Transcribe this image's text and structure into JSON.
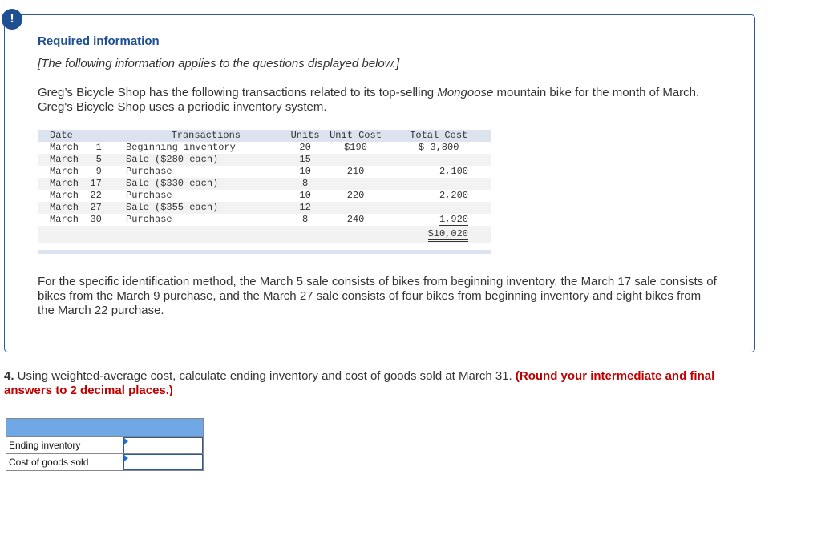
{
  "alert_icon": "!",
  "info": {
    "title": "Required information",
    "subtitle": "[The following information applies to the questions displayed below.]",
    "intro_part1": "Greg’s Bicycle Shop has the following transactions related to its top-selling ",
    "intro_italic": "Mongoose",
    "intro_part2": " mountain bike for the month of March. Greg's Bicycle Shop uses a periodic inventory system.",
    "table": {
      "headers": [
        "Date",
        "Transactions",
        "Units",
        "Unit Cost",
        "Total Cost"
      ],
      "rows": [
        {
          "date": "March   1",
          "transaction": "Beginning inventory",
          "units": "20",
          "unit_cost": "$190",
          "total_cost": "$ 3,800"
        },
        {
          "date": "March   5",
          "transaction": "Sale ($280 each)",
          "units": "15",
          "unit_cost": "",
          "total_cost": ""
        },
        {
          "date": "March   9",
          "transaction": "Purchase",
          "units": "10",
          "unit_cost": "210",
          "total_cost": "2,100"
        },
        {
          "date": "March  17",
          "transaction": "Sale ($330 each)",
          "units": "8",
          "unit_cost": "",
          "total_cost": ""
        },
        {
          "date": "March  22",
          "transaction": "Purchase",
          "units": "10",
          "unit_cost": "220",
          "total_cost": "2,200"
        },
        {
          "date": "March  27",
          "transaction": "Sale ($355 each)",
          "units": "12",
          "unit_cost": "",
          "total_cost": ""
        },
        {
          "date": "March  30",
          "transaction": "Purchase",
          "units": "8",
          "unit_cost": "240",
          "total_cost": "1,920"
        }
      ],
      "total": "$10,020"
    },
    "specific_id_text": "For the specific identification method, the March 5 sale consists of bikes from beginning inventory, the March 17 sale consists of bikes from the March 9 purchase, and the March 27 sale consists of four bikes from beginning inventory and eight bikes from the March 22 purchase."
  },
  "question": {
    "number": "4.",
    "text": " Using weighted-average cost, calculate ending inventory and cost of goods sold at March 31. ",
    "instruction": "(Round your intermediate and final answers to 2 decimal places.)"
  },
  "answer_table": {
    "rows": [
      {
        "label": "Ending inventory",
        "value": ""
      },
      {
        "label": "Cost of goods sold",
        "value": ""
      }
    ]
  }
}
